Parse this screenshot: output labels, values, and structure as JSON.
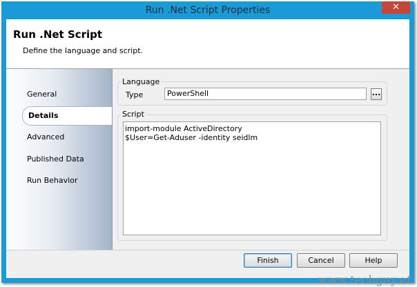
{
  "window": {
    "title": "Run .Net Script Properties",
    "close_glyph": "✕"
  },
  "header": {
    "title": "Run .Net Script",
    "subtitle": "Define the language and script."
  },
  "sidebar": {
    "items": [
      {
        "label": "General"
      },
      {
        "label": "Details",
        "selected": true
      },
      {
        "label": "Advanced"
      },
      {
        "label": "Published Data"
      },
      {
        "label": "Run Behavior"
      }
    ]
  },
  "language": {
    "group_label": "Language",
    "type_label": "Type",
    "type_value": "PowerShell",
    "browse_label": "..."
  },
  "script": {
    "group_label": "Script",
    "content": "import-module ActiveDirectory\n$User=Get-Aduser -identity seidlm"
  },
  "buttons": {
    "finish": "Finish",
    "cancel": "Cancel",
    "help": "Help"
  },
  "watermark": "www.techguy.at",
  "colors": {
    "titlebar": "#1b9ad8",
    "close": "#c7463c",
    "dialog_bg": "#f0f0f0"
  }
}
